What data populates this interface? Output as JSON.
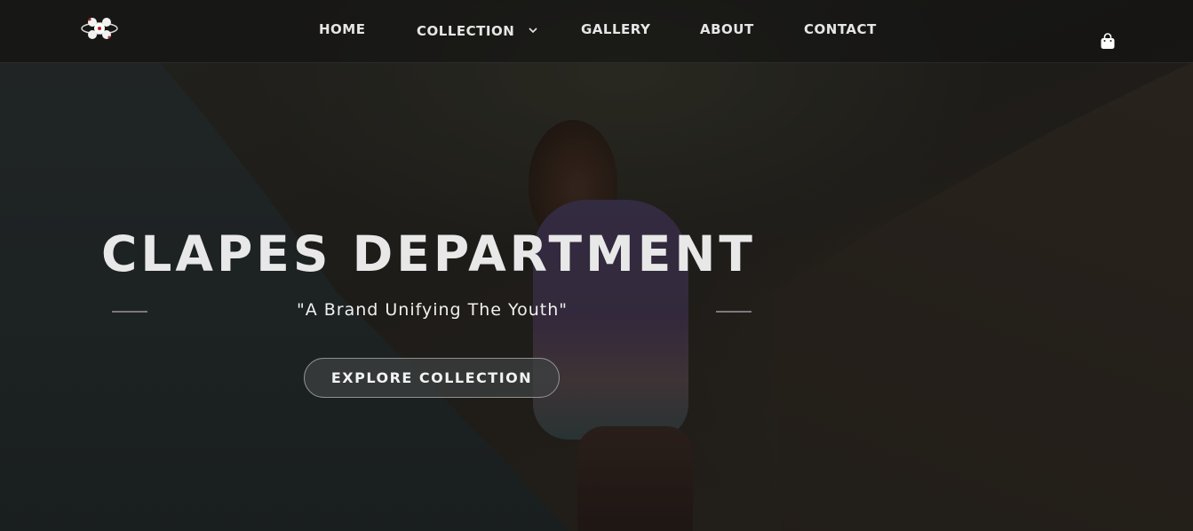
{
  "nav": {
    "items": [
      {
        "label": "HOME"
      },
      {
        "label": "COLLECTION",
        "has_dropdown": true,
        "dropdown_icon": "chevron-down-icon"
      },
      {
        "label": "GALLERY"
      },
      {
        "label": "ABOUT"
      },
      {
        "label": "CONTACT"
      }
    ],
    "logo_icon": "brand-logo-icon",
    "cart_icon": "shopping-bag-icon"
  },
  "hero": {
    "title": "CLAPES DEPARTMENT",
    "tagline": "\"A Brand Unifying The Youth\"",
    "cta_label": "EXPLORE COLLECTION"
  },
  "colors": {
    "nav_text": "#e6e6e6",
    "title_text": "#e8e8e8",
    "button_bg": "#3e4041",
    "button_border": "#8f9191",
    "divider": "#7a7a7a"
  }
}
